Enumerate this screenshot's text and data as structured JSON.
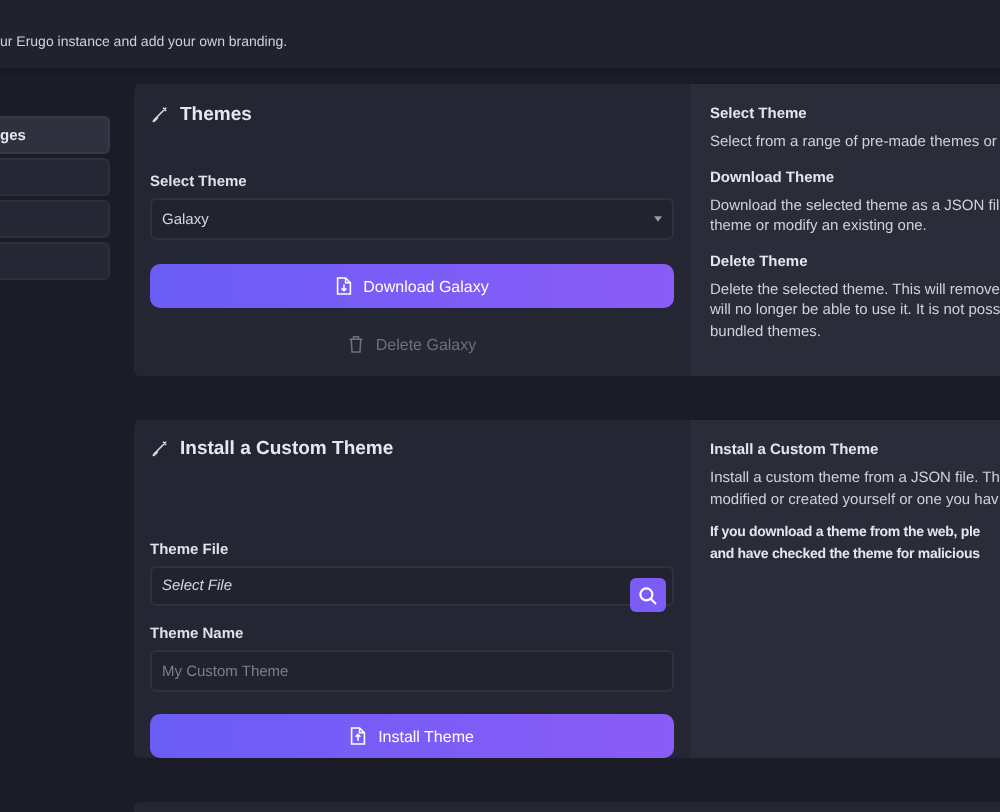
{
  "header": {
    "subtitle": "ur Erugo instance and add your own branding."
  },
  "sidebar": {
    "items": [
      {
        "label": "ges",
        "selected": true
      },
      {
        "selected": false
      },
      {
        "selected": false
      },
      {
        "selected": false
      }
    ]
  },
  "themes_card": {
    "title": "Themes",
    "select_label": "Select Theme",
    "select_value": "Galaxy",
    "download_button": "Download Galaxy",
    "delete_button": {
      "label": "Delete Galaxy",
      "disabled": true
    },
    "help": [
      {
        "heading": "Select Theme",
        "lines": [
          "Select from a range of pre-made themes or"
        ]
      },
      {
        "heading": "Download Theme",
        "lines": [
          "Download the selected theme as a JSON fil",
          "theme or modify an existing one."
        ]
      },
      {
        "heading": "Delete Theme",
        "lines": [
          "Delete the selected theme. This will remove",
          "will no longer be able to use it. It is not poss",
          "bundled themes."
        ]
      }
    ]
  },
  "install_card": {
    "title": "Install a Custom Theme",
    "file_label": "Theme File",
    "file_value": "Select File",
    "name_label": "Theme Name",
    "name_placeholder": "My Custom Theme",
    "install_button": "Install Theme",
    "help": [
      {
        "heading": "Install a Custom Theme",
        "lines": [
          "Install a custom theme from a JSON file. Th",
          "modified or created yourself or one you hav"
        ]
      },
      {
        "strong": true,
        "lines": [
          "If you download a theme from the web, ple",
          "and have checked the theme for malicious"
        ]
      }
    ]
  }
}
